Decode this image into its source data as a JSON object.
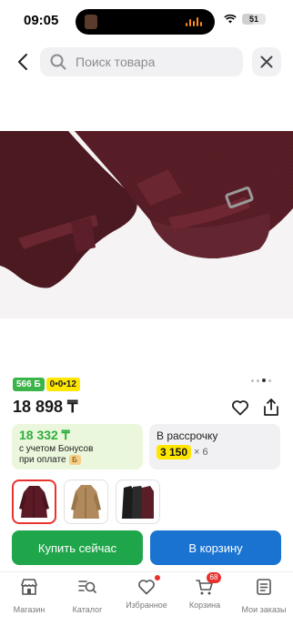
{
  "status_bar": {
    "time": "09:05",
    "battery": "51"
  },
  "search": {
    "placeholder": "Поиск товара"
  },
  "product": {
    "bonus_badge": "566 Б",
    "installment_badge": "0•0•12",
    "price": "18 898 ₸"
  },
  "bonus_card": {
    "amount": "18 332 ₸",
    "line1": "с учетом Бонусов",
    "line2": "при оплате",
    "coin_icon": "Б"
  },
  "installment_card": {
    "title": "В рассрочку",
    "monthly": "3 150",
    "multiplier": "× 6"
  },
  "variants": [
    {
      "name": "burgundy-coat",
      "color": "#5c1a26"
    },
    {
      "name": "camel-coat",
      "color": "#b08a5c"
    },
    {
      "name": "black-coat",
      "color": "#1c1c1c"
    }
  ],
  "actions": {
    "buy_now": "Купить сейчас",
    "add_to_cart": "В корзину"
  },
  "tabbar": {
    "items": [
      {
        "label": "Магазин",
        "icon": "shop-icon"
      },
      {
        "label": "Каталог",
        "icon": "catalog-search-icon"
      },
      {
        "label": "Избранное",
        "icon": "heart-icon"
      },
      {
        "label": "Корзина",
        "icon": "cart-icon",
        "badge": "68"
      },
      {
        "label": "Мои заказы",
        "icon": "orders-icon"
      }
    ]
  },
  "colors": {
    "accent_green": "#1fa64a",
    "accent_blue": "#1a73d0",
    "badge_red": "#e8322e",
    "installment_yellow": "#ffe600"
  }
}
